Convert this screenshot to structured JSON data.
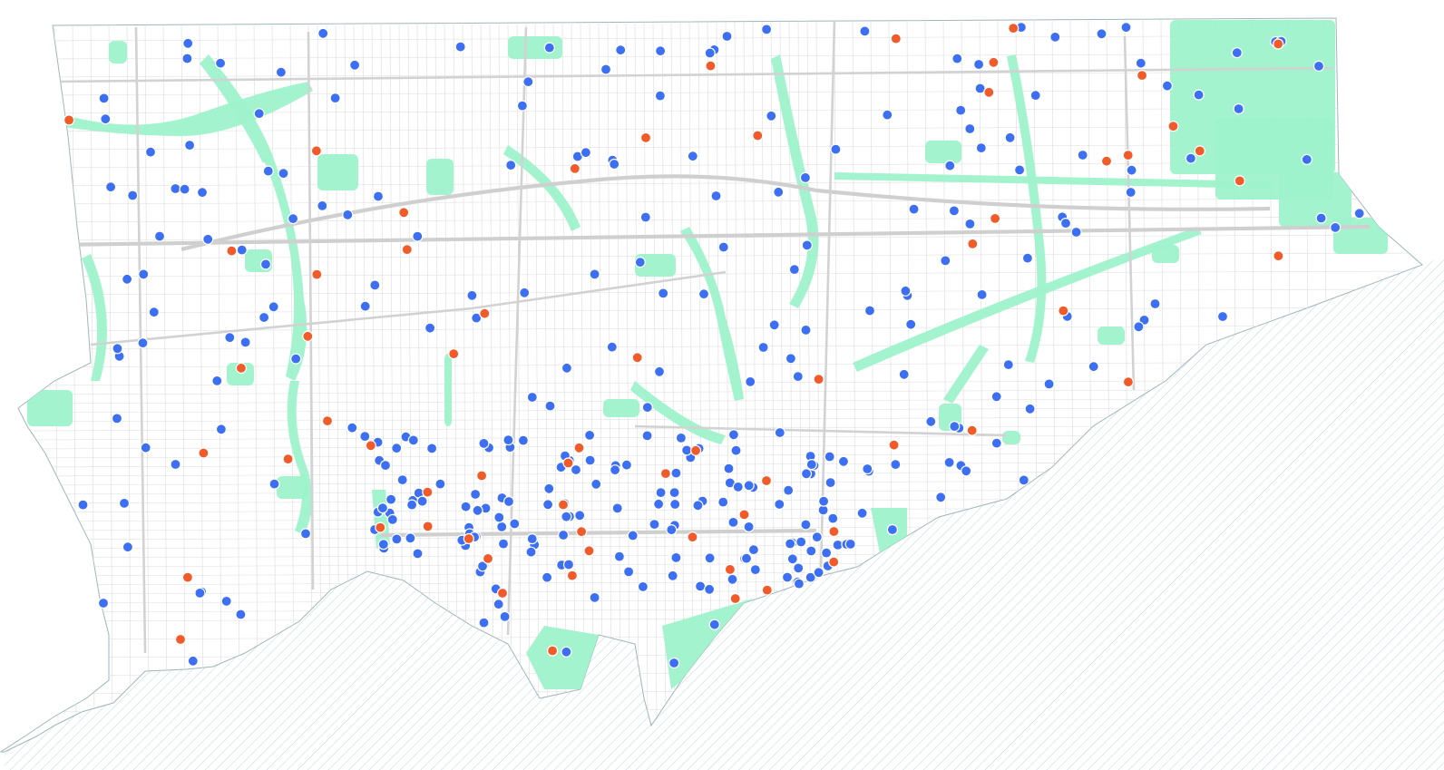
{
  "map": {
    "title": "",
    "colors": {
      "land": "#ffffff",
      "water_hatch": "#b8d8de",
      "park": "#9ef2cc",
      "street": "#dcdcdc",
      "highway": "#cfcfcf",
      "marker_blue": "#3d6ff2",
      "marker_orange": "#f15b2a"
    },
    "layers": [
      "streets",
      "parks",
      "water",
      "markers"
    ],
    "marker_categories": [
      {
        "name": "blue",
        "count": 327
      },
      {
        "name": "orange",
        "count": 64
      }
    ]
  }
}
